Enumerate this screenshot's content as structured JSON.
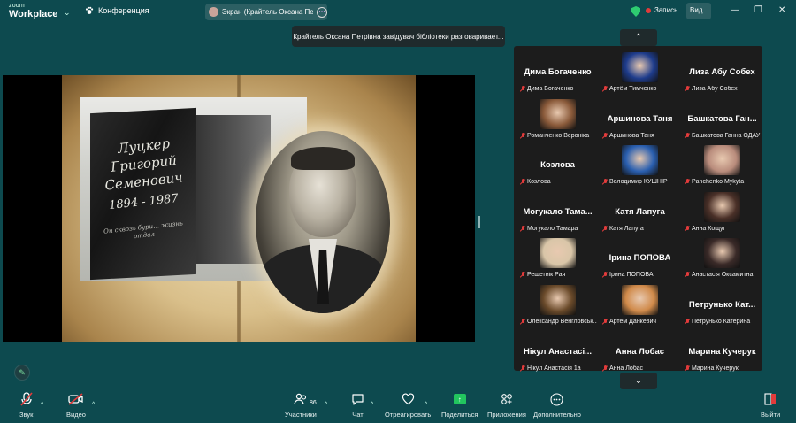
{
  "app": {
    "logo_top": "zoom",
    "logo_bottom": "Workplace",
    "conference_label": "Конференция"
  },
  "share_pill": {
    "text": "Экран (Крайтель Оксана Петрі"
  },
  "topbar": {
    "record_label": "Запись",
    "view_label": "Вид"
  },
  "toast": {
    "text": "Крайтель Оксана Петрівна завідувач бібліотеки разговариваeт..."
  },
  "slide": {
    "epitaph_line1": "Луцкер",
    "epitaph_line2": "Григорий",
    "epitaph_line3": "Семенович",
    "epitaph_dates": "1894 - 1987",
    "epitaph_small": "Он сквозь бури… жизнь отдал"
  },
  "gallery": {
    "tiles": [
      {
        "name": "Дима Богаченко",
        "caption": "Дима Богаченко",
        "video": false
      },
      {
        "name": "",
        "caption": "Артём Тимченко",
        "video": true,
        "color": "#1e3c8c"
      },
      {
        "name": "Лиза Абу Собех",
        "caption": "Лиза Абу Собех",
        "video": false
      },
      {
        "name": "",
        "caption": "Романченко Вероніка",
        "video": true,
        "color": "#8a5a3a"
      },
      {
        "name": "Аршинова Таня",
        "caption": "Аршинова Таня",
        "video": false
      },
      {
        "name": "Башкатова Ган...",
        "caption": "Башкатова Ганна ОДАУ",
        "video": false
      },
      {
        "name": "Козлова",
        "caption": "Козлова",
        "video": false
      },
      {
        "name": "",
        "caption": "Володимир КУШНІР",
        "video": true,
        "color": "#2a5fb0"
      },
      {
        "name": "",
        "caption": "Panchenko Mykyta",
        "video": true,
        "color": "#b98c7c"
      },
      {
        "name": "Могукало Тама...",
        "caption": "Могукало Тамара",
        "video": false
      },
      {
        "name": "Катя Лапуга",
        "caption": "Катя Лапуга",
        "video": false
      },
      {
        "name": "",
        "caption": "Анна Кощуг",
        "video": true,
        "color": "#4a3028"
      },
      {
        "name": "",
        "caption": "Решетнік Рая",
        "video": true,
        "color": "#d9c6a8"
      },
      {
        "name": "Ірина ПОПОВА",
        "caption": "Ірина ПОПОВА",
        "video": false
      },
      {
        "name": "",
        "caption": "Анастасія Оксамитна",
        "video": true,
        "color": "#3a2a28"
      },
      {
        "name": "",
        "caption": "Олександр Венгловськ...",
        "video": true,
        "color": "#6a4a2a"
      },
      {
        "name": "",
        "caption": "Артем Данкевич",
        "video": true,
        "color": "#d08a4a"
      },
      {
        "name": "Петрунько Кат...",
        "caption": "Петрунько Катерина",
        "video": false
      },
      {
        "name": "Нікул Анастасі...",
        "caption": "Нікул Анастасія 1а",
        "video": false
      },
      {
        "name": "Анна Лобас",
        "caption": "Анна Лобас",
        "video": false
      },
      {
        "name": "Марина Кучерук",
        "caption": "Марина Кучерук",
        "video": false
      }
    ]
  },
  "toolbar": {
    "audio": "Звук",
    "video": "Видео",
    "participants": "Участники",
    "participants_count": "86",
    "chat": "Чат",
    "react": "Отреагировать",
    "share": "Поделиться",
    "apps": "Приложения",
    "more": "Дополнительно",
    "leave": "Выйти"
  },
  "colors": {
    "background": "#0d4a4f",
    "gallery_bg": "#1c1c1c",
    "mute_red": "#e23b3b",
    "share_green": "#22c55e"
  }
}
